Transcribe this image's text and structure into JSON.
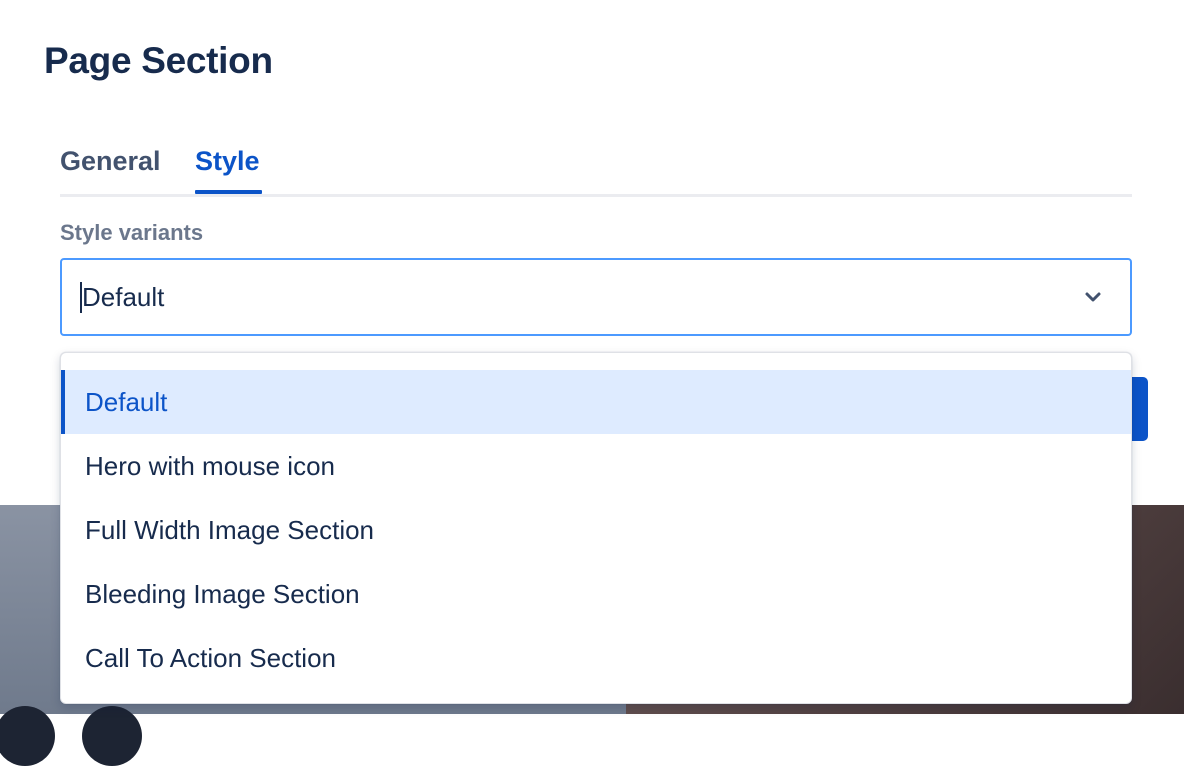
{
  "dialog": {
    "title": "Page Section"
  },
  "tabs": [
    {
      "label": "General",
      "active": false
    },
    {
      "label": "Style",
      "active": true
    }
  ],
  "style_field": {
    "label": "Style variants",
    "value": "Default",
    "icon": "chevron-down-icon"
  },
  "dropdown": {
    "options": [
      {
        "label": "Default",
        "selected": true
      },
      {
        "label": "Hero with mouse icon",
        "selected": false
      },
      {
        "label": "Full Width Image Section",
        "selected": false
      },
      {
        "label": "Bleeding Image Section",
        "selected": false
      },
      {
        "label": "Call To Action Section",
        "selected": false
      }
    ]
  },
  "colors": {
    "accent": "#0c54c8",
    "focus_border": "#4c9aff",
    "selected_bg": "#deebff",
    "text": "#172b4d"
  }
}
